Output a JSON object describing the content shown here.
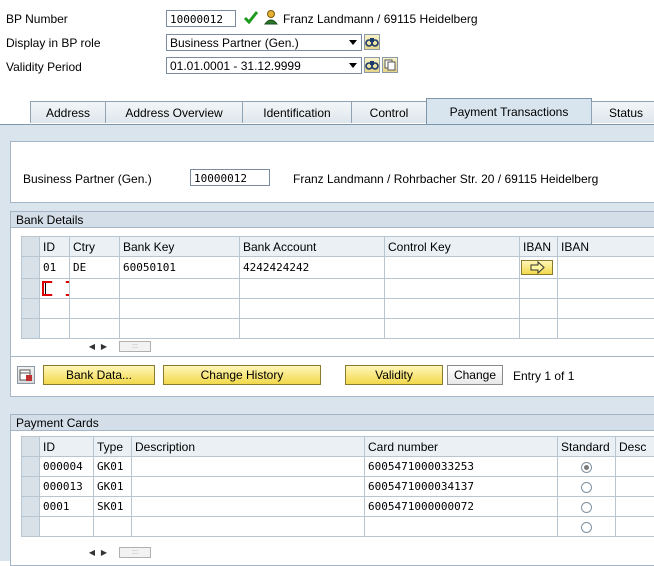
{
  "header": {
    "bp_number_label": "BP Number",
    "bp_number_value": "10000012",
    "bp_name": "Franz Landmann / 69115 Heidelberg",
    "display_role_label": "Display in BP role",
    "display_role_value": "Business Partner (Gen.)",
    "validity_label": "Validity Period",
    "validity_value": "01.01.0001 - 31.12.9999"
  },
  "tabs": [
    {
      "label": "Address"
    },
    {
      "label": "Address Overview"
    },
    {
      "label": "Identification"
    },
    {
      "label": "Control"
    },
    {
      "label": "Payment Transactions"
    },
    {
      "label": "Status"
    }
  ],
  "active_tab": "Payment Transactions",
  "bp_info": {
    "label": "Business Partner (Gen.)",
    "value": "10000012",
    "address": "Franz Landmann / Rohrbacher Str. 20 / 69115 Heidelberg"
  },
  "bank_details": {
    "title": "Bank Details",
    "columns": [
      "ID",
      "Ctry",
      "Bank Key",
      "Bank Account",
      "Control Key",
      "IBAN",
      "IBAN"
    ],
    "rows": [
      {
        "id": "01",
        "ctry": "DE",
        "bank_key": "60050101",
        "bank_account": "4242424242",
        "control_key": ""
      }
    ],
    "buttons": {
      "bank_data": "Bank Data...",
      "change_history": "Change History",
      "validity": "Validity",
      "change": "Change"
    },
    "entry_text": "Entry 1 of 1"
  },
  "payment_cards": {
    "title": "Payment Cards",
    "columns": [
      "ID",
      "Type",
      "Description",
      "Card number",
      "Standard",
      "Desc"
    ],
    "rows": [
      {
        "id": "000004",
        "type": "GK01",
        "description": "",
        "card_number": "6005471000033253",
        "standard": true
      },
      {
        "id": "000013",
        "type": "GK01",
        "description": "",
        "card_number": "6005471000034137",
        "standard": false
      },
      {
        "id": "0001",
        "type": "SK01",
        "description": "",
        "card_number": "6005471000000072",
        "standard": false
      },
      {
        "id": "",
        "type": "",
        "description": "",
        "card_number": "",
        "standard": false
      }
    ]
  },
  "colors": {
    "accent_tab": "#d9e5ee",
    "group_header": "#d3dee8",
    "button_yellow": "#f2d94c",
    "check_green": "#1e9a1e"
  },
  "icons": [
    "check-icon",
    "person-icon",
    "binoculars-icon",
    "copy-icon",
    "arrow-right-icon",
    "table-settings-icon"
  ]
}
